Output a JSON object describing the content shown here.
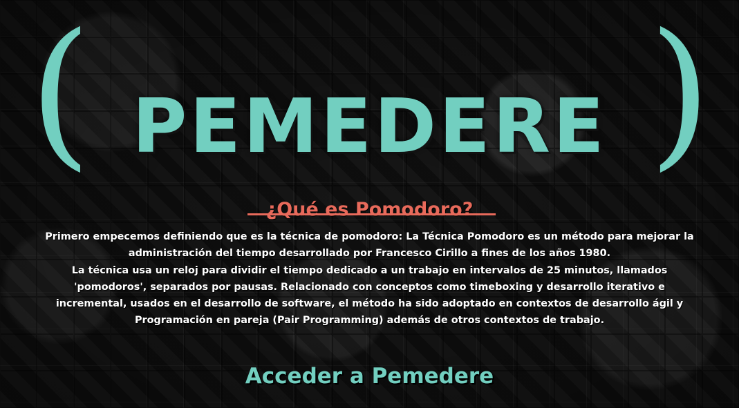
{
  "header": {
    "title": "PEMEDERE",
    "paren_left": "(",
    "paren_right": ")"
  },
  "section": {
    "title": "¿Qué es Pomodoro?",
    "paragraph_1": "Primero empecemos definiendo que es la técnica de pomodoro: La Técnica Pomodoro es un método para mejorar la administración del tiempo desarrollado por Francesco Cirillo a fines de los años 1980.",
    "paragraph_2": "La técnica usa un reloj para dividir el tiempo dedicado a un trabajo en intervalos de 25 minutos, llamados 'pomodoros', separados por pausas. Relacionado con conceptos como timeboxing y desarrollo iterativo e incremental, usados en el desarrollo de software, el método ha sido adoptado en contextos de desarrollo ágil y Programación en pareja (Pair Programming) además de otros contextos de trabajo."
  },
  "cta": {
    "label": "Acceder a Pemedere"
  },
  "colors": {
    "accent_teal": "#72cfc0",
    "accent_coral": "#e86a5b",
    "background": "#0d0d0d"
  }
}
